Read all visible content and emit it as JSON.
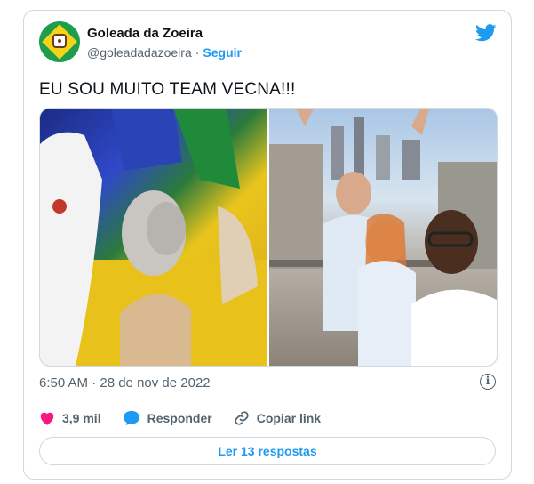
{
  "author": {
    "name": "Goleada da Zoeira",
    "handle": "@goleadadazoeira",
    "separator": "·",
    "follow_label": "Seguir"
  },
  "tweet": {
    "text": "EU SOU MUITO TEAM VECNA!!!",
    "timestamp": "6:50 AM · 28 de nov de 2022"
  },
  "media": {
    "photos": [
      {
        "icon": "photo-fans-brazil"
      },
      {
        "icon": "photo-group-selfie-argentina"
      }
    ]
  },
  "actions": {
    "likes": "3,9 mil",
    "reply_label": "Responder",
    "copy_label": "Copiar link"
  },
  "read_replies_label": "Ler 13 respostas",
  "colors": {
    "accent": "#1d9bf0",
    "like": "#f91880",
    "text": "#0f1419",
    "muted": "#536471",
    "border": "#cfd9de"
  }
}
